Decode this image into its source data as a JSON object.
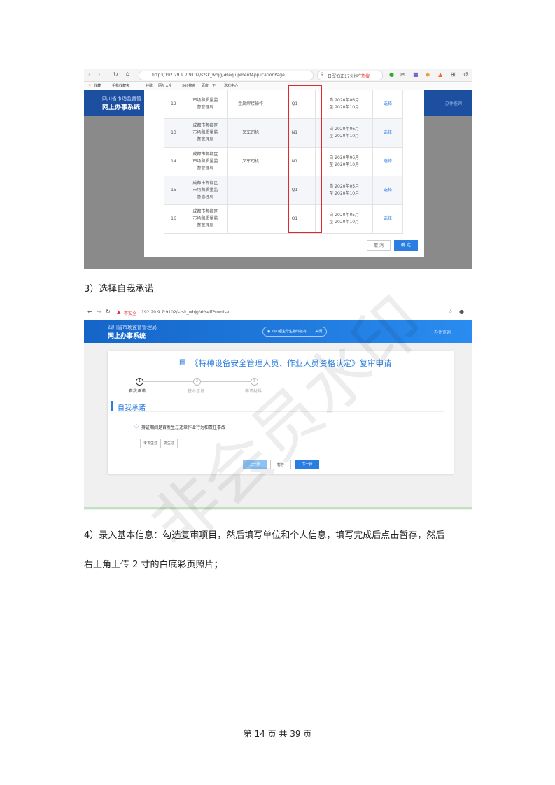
{
  "screenshot1": {
    "address": "http://192.29.9.7:9102/szsk_wbjg/#/equipmentApplicationPage",
    "search_hint": "日军怕正17头拖牛",
    "hot_label": "热搜",
    "bookmarks": [
      "收藏",
      "手机收藏夹",
      "谷歌",
      "网址大全",
      "360搜索",
      "百度一下",
      "游戏中心"
    ],
    "header_title_line1": "四川省市场监督管",
    "header_title_line2": "网上办事系统",
    "header_right": "办件查询",
    "rows": [
      {
        "no": "12",
        "org": [
          "市场和质量监",
          "督管理局"
        ],
        "item": "金属焊接操作",
        "code": "Q1",
        "period": [
          "自 2020年06月",
          "至 2020年10月"
        ],
        "action": "选择"
      },
      {
        "no": "13",
        "org": [
          "成都市郫都区",
          "市场和质量监",
          "督管理局"
        ],
        "item": "叉车司机",
        "code": "N1",
        "period": [
          "自 2020年06月",
          "至 2020年10月"
        ],
        "action": "选择"
      },
      {
        "no": "14",
        "org": [
          "成都市郫都区",
          "市场和质量监",
          "督管理局"
        ],
        "item": "叉车司机",
        "code": "N1",
        "period": [
          "自 2020年06月",
          "至 2020年10月"
        ],
        "action": "选择"
      },
      {
        "no": "15",
        "org": [
          "成都市郫都区",
          "市场和质量监",
          "督管理局"
        ],
        "item": "",
        "code": "Q1",
        "period": [
          "自 2020年05月",
          "至 2020年10月"
        ],
        "action": "选择"
      },
      {
        "no": "16",
        "org": [
          "成都市郫都区",
          "市场和质量监",
          "督管理局"
        ],
        "item": "",
        "code": "Q1",
        "period": [
          "自 2020年05月",
          "至 2020年10月"
        ],
        "action": "选择"
      }
    ],
    "cancel_label": "取 消",
    "ok_label": "确 定"
  },
  "heading3": "3）选择自我承诺",
  "screenshot2": {
    "insecure_label": "不安全",
    "address": "192.29.9.7:9102/szsk_wbjg/#/selfPromise",
    "header_title_line1": "四川省市场监督管理局",
    "header_title_line2": "网上办事系统",
    "header_center": "四川福宝华生物科技有...",
    "header_close": "关闭",
    "header_right": "办件查询",
    "form_title": "《特种设备安全管理人员、作业人员资格认定》复审申请",
    "steps": [
      {
        "num": "1",
        "label": "自我承诺"
      },
      {
        "num": "2",
        "label": "基本信息"
      },
      {
        "num": "3",
        "label": "申请材料"
      }
    ],
    "section_title": "自我承诺",
    "question": "持证期间是否发生过违章作业行为和责任事故",
    "options": [
      "未发生过",
      "发生过"
    ],
    "btn_prev": "上一步",
    "btn_save": "暂存",
    "btn_next": "下一步"
  },
  "para4_line1": "4）录入基本信息：勾选复审项目，然后填写单位和个人信息，填写完成后点击暂存，然后",
  "para4_line2": "右上角上传 2 寸的白底彩页照片；",
  "footer": "第 14 页 共 39 页",
  "watermark": "非会员水印",
  "colors": {
    "header_blue": "#1c4fa0",
    "accent_blue": "#2a7de1",
    "highlight_red": "#e0282e"
  }
}
